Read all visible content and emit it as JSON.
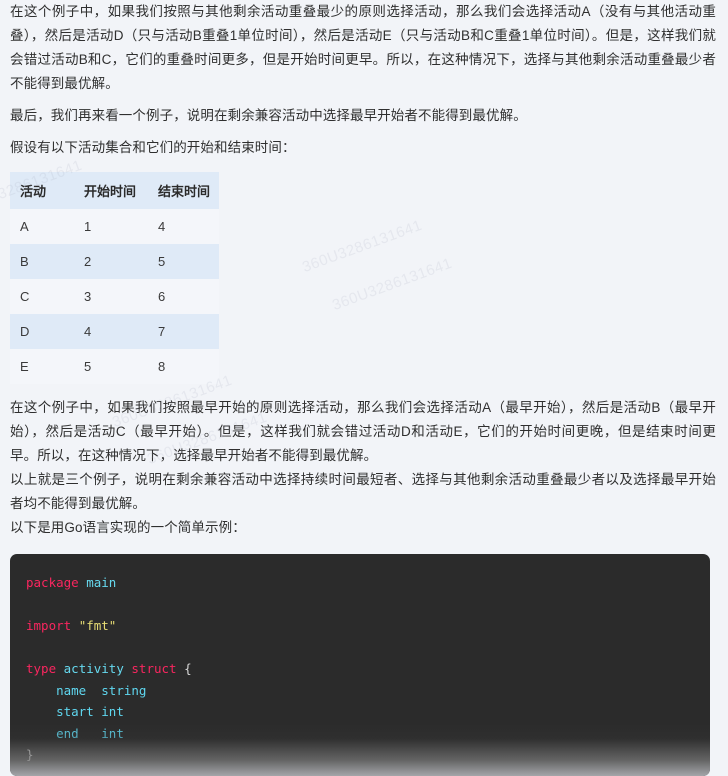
{
  "page": {
    "background_color": "#f2f4f8",
    "watermark_text": "360U3286131641"
  },
  "paragraphs": {
    "p1": "在这个例子中，如果我们按照与其他剩余活动重叠最少的原则选择活动，那么我们会选择活动A（没有与其他活动重叠），然后是活动D（只与活动B重叠1单位时间），然后是活动E（只与活动B和C重叠1单位时间）。但是，这样我们就会错过活动B和C，它们的重叠时间更多，但是开始时间更早。所以，在这种情况下，选择与其他剩余活动重叠最少者不能得到最优解。",
    "p2": "最后，我们再来看一个例子，说明在剩余兼容活动中选择最早开始者不能得到最优解。",
    "p3": "假设有以下活动集合和它们的开始和结束时间：",
    "p4": "在这个例子中，如果我们按照最早开始的原则选择活动，那么我们会选择活动A（最早开始），然后是活动B（最早开始），然后是活动C（最早开始）。但是，这样我们就会错过活动D和活动E，它们的开始时间更晚，但是结束时间更早。所以，在这种情况下，选择最早开始者不能得到最优解。",
    "p5": "以上就是三个例子，说明在剩余兼容活动中选择持续时间最短者、选择与其他剩余活动重叠最少者以及选择最早开始者均不能得到最优解。",
    "p6": "以下是用Go语言实现的一个简单示例："
  },
  "table": {
    "headers": [
      "活动",
      "开始时间",
      "结束时间"
    ],
    "rows": [
      [
        "A",
        "1",
        "4"
      ],
      [
        "B",
        "2",
        "5"
      ],
      [
        "C",
        "3",
        "6"
      ],
      [
        "D",
        "4",
        "7"
      ],
      [
        "E",
        "5",
        "8"
      ]
    ],
    "header_bg": "#dfeaf7",
    "row_odd_bg": "#f4f6fa",
    "row_even_bg": "#dfeaf7"
  },
  "code": {
    "language": "Go",
    "background": "#2b2b2b",
    "lines": [
      "package main",
      "",
      "import \"fmt\"",
      "",
      "type activity struct {",
      "    name  string",
      "    start int",
      "    end   int",
      "}"
    ],
    "tokens": {
      "package": "package",
      "main": "main",
      "import": "import",
      "fmt_string": "\"fmt\"",
      "type": "type",
      "activity": "activity",
      "struct": "struct",
      "brace_open": "{",
      "field_name": "name",
      "type_string": "string",
      "field_start": "start",
      "type_int_1": "int",
      "field_end": "end",
      "type_int_2": "int",
      "brace_close": "}"
    },
    "colors": {
      "keyword": "#f9265f",
      "identifier": "#66d9ef",
      "string": "#e6db74",
      "plain": "#cfcfcf"
    }
  }
}
